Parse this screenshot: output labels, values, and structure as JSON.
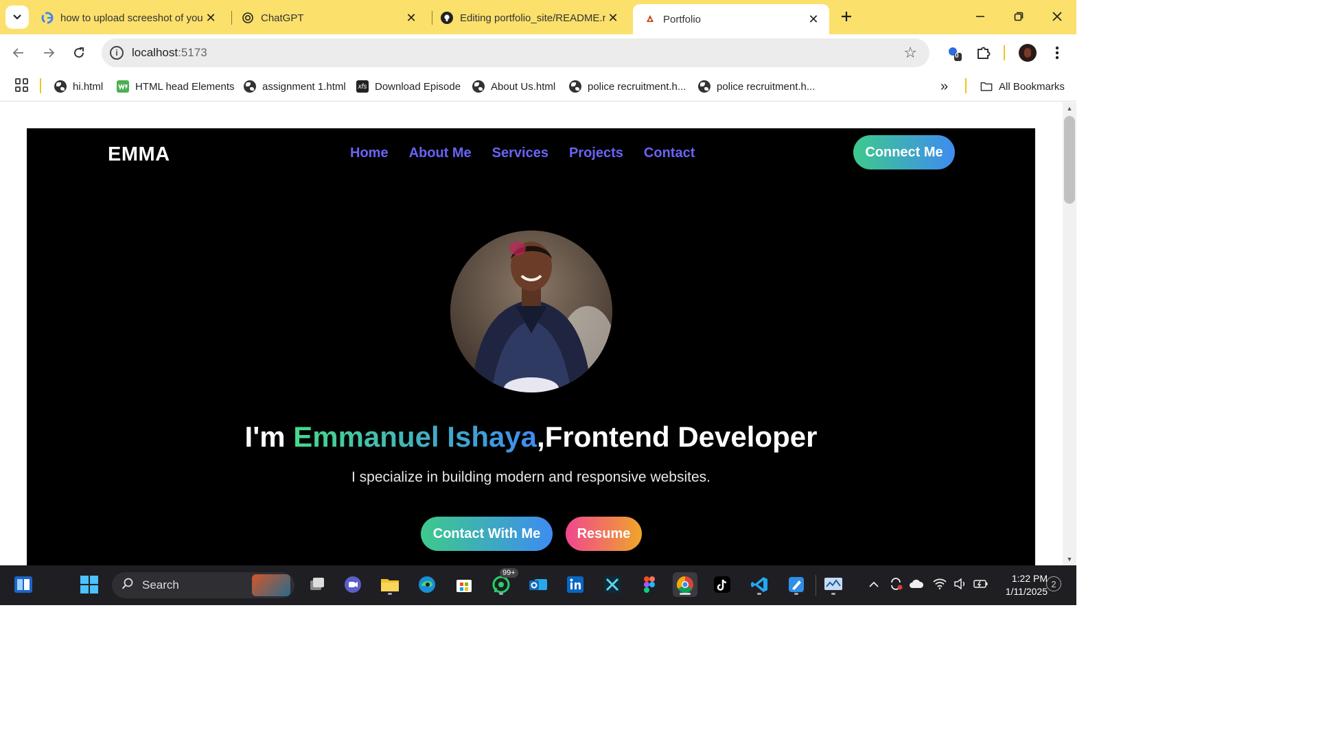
{
  "browser": {
    "tabs": [
      {
        "title": "how to upload screeshot of you",
        "favicon": "google-icon"
      },
      {
        "title": "ChatGPT",
        "favicon": "chatgpt-icon"
      },
      {
        "title": "Editing portfolio_site/README.r",
        "favicon": "github-icon"
      },
      {
        "title": "Portfolio",
        "favicon": "react-icon",
        "active": true
      }
    ],
    "address": {
      "host": "localhost",
      "port": ":5173"
    },
    "extension_badge": "0",
    "bookmarks": [
      {
        "label": "hi.html",
        "icon": "globe-icon"
      },
      {
        "label": "HTML head Elements",
        "icon": "w3schools-icon"
      },
      {
        "label": "assignment 1.html",
        "icon": "globe-icon"
      },
      {
        "label": "Download Episode",
        "icon": "xfs-icon",
        "icon_text": "xfs"
      },
      {
        "label": "About Us.html",
        "icon": "globe-icon"
      },
      {
        "label": "police recruitment.h...",
        "icon": "globe-icon"
      },
      {
        "label": "police recruitment.h...",
        "icon": "globe-icon"
      }
    ],
    "all_bookmarks": "All Bookmarks",
    "overflow": "»"
  },
  "site": {
    "logo": "EMMA",
    "nav": [
      "Home",
      "About Me",
      "Services",
      "Projects",
      "Contact"
    ],
    "connect_button": "Connect Me",
    "headline": {
      "prefix": "I'm ",
      "name": "Emmanuel Ishaya",
      "suffix": ",Frontend Developer"
    },
    "subtitle": "I specialize in building modern and responsive websites.",
    "cta_contact": "Contact With Me",
    "cta_resume": "Resume"
  },
  "taskbar": {
    "search_placeholder": "Search",
    "whatsapp_badge": "99+",
    "time": "1:22 PM",
    "date": "1/11/2025",
    "notifications": "2"
  },
  "colors": {
    "tabstrip": "#fbe06b",
    "nav_link": "#6a63f6",
    "gradient_green": "#3ec98c",
    "gradient_blue": "#3e8cf0",
    "resume_pink": "#f0478f",
    "resume_orange": "#f0a52a"
  }
}
